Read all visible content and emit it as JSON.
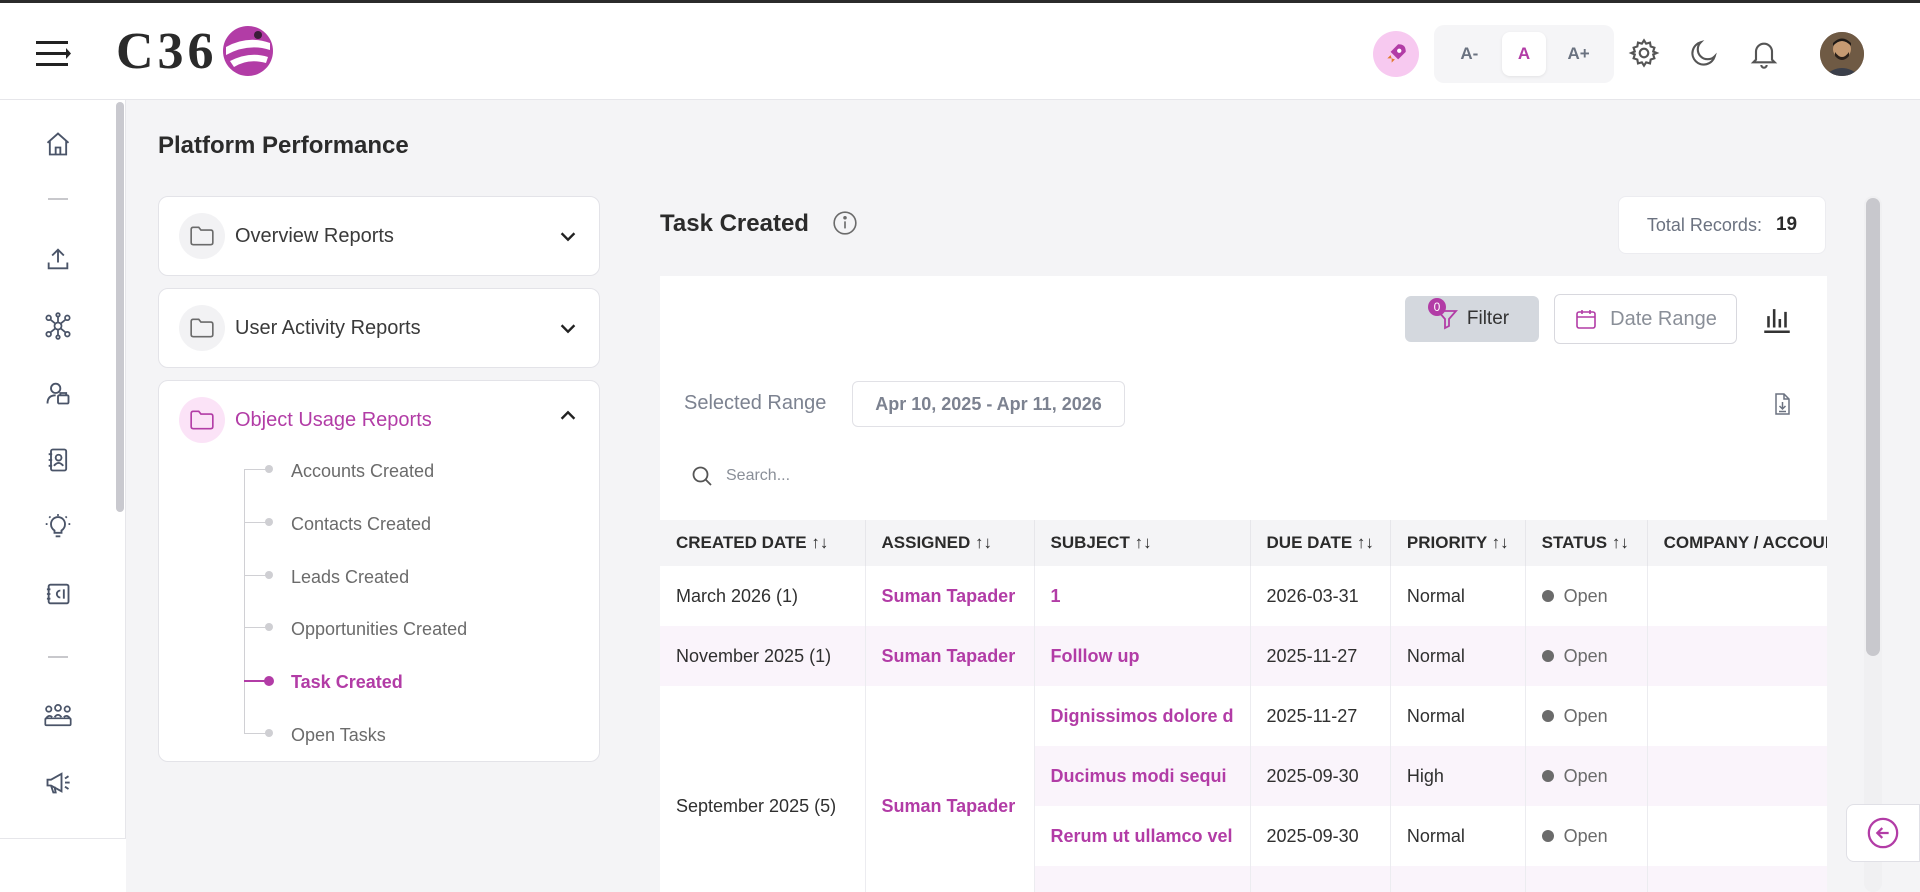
{
  "header": {
    "logo_text": "C36",
    "font_sizes": [
      "A-",
      "A",
      "A+"
    ],
    "active_font_size": "A"
  },
  "page": {
    "title": "Platform Performance"
  },
  "reports_menu": {
    "sections": [
      {
        "label": "Overview Reports",
        "expanded": false
      },
      {
        "label": "User Activity Reports",
        "expanded": false
      },
      {
        "label": "Object Usage Reports",
        "expanded": true
      }
    ],
    "object_usage_items": [
      "Accounts Created",
      "Contacts Created",
      "Leads Created",
      "Opportunities Created",
      "Task Created",
      "Open Tasks"
    ],
    "active_item": "Task Created"
  },
  "report": {
    "title": "Task Created",
    "total_label": "Total Records:",
    "total_value": "19",
    "filter_label": "Filter",
    "filter_count": "0",
    "date_range_label": "Date Range",
    "selected_range_label": "Selected Range",
    "selected_range_value": "Apr 10, 2025 - Apr 11, 2026",
    "search_placeholder": "Search..."
  },
  "table": {
    "columns": [
      "CREATED DATE",
      "ASSIGNED",
      "SUBJECT",
      "DUE DATE",
      "PRIORITY",
      "STATUS",
      "COMPANY / ACCOUNT"
    ],
    "groups": [
      {
        "created": "March 2026 (1)",
        "assigned": "Suman Tapader",
        "rows": [
          {
            "subject": "1",
            "due": "2026-03-31",
            "priority": "Normal",
            "status": "Open"
          }
        ]
      },
      {
        "created": "November 2025 (1)",
        "assigned": "Suman Tapader",
        "rows": [
          {
            "subject": "Folllow up",
            "due": "2025-11-27",
            "priority": "Normal",
            "status": "Open"
          }
        ]
      },
      {
        "created": "September 2025 (5)",
        "assigned": "Suman Tapader",
        "rows": [
          {
            "subject": "Dignissimos dolore d",
            "due": "2025-11-27",
            "priority": "Normal",
            "status": "Open"
          },
          {
            "subject": "Ducimus modi sequi",
            "due": "2025-09-30",
            "priority": "High",
            "status": "Open"
          },
          {
            "subject": "Rerum ut ullamco vel",
            "due": "2025-09-30",
            "priority": "Normal",
            "status": "Open"
          }
        ]
      }
    ]
  },
  "colors": {
    "accent": "#b23ca6",
    "accent_light": "#fbe3f7",
    "row_alt": "#faf4fb"
  },
  "icons": {
    "hamburger": "menu-icon",
    "rocket": "rocket-icon",
    "settings": "gear-icon",
    "theme": "moon-icon",
    "notifications": "bell-icon",
    "sidebar": [
      "home-icon",
      "upload-icon",
      "network-icon",
      "users-icon",
      "contacts-icon",
      "bulb-icon",
      "card-icon",
      "group-icon",
      "megaphone-icon"
    ]
  }
}
